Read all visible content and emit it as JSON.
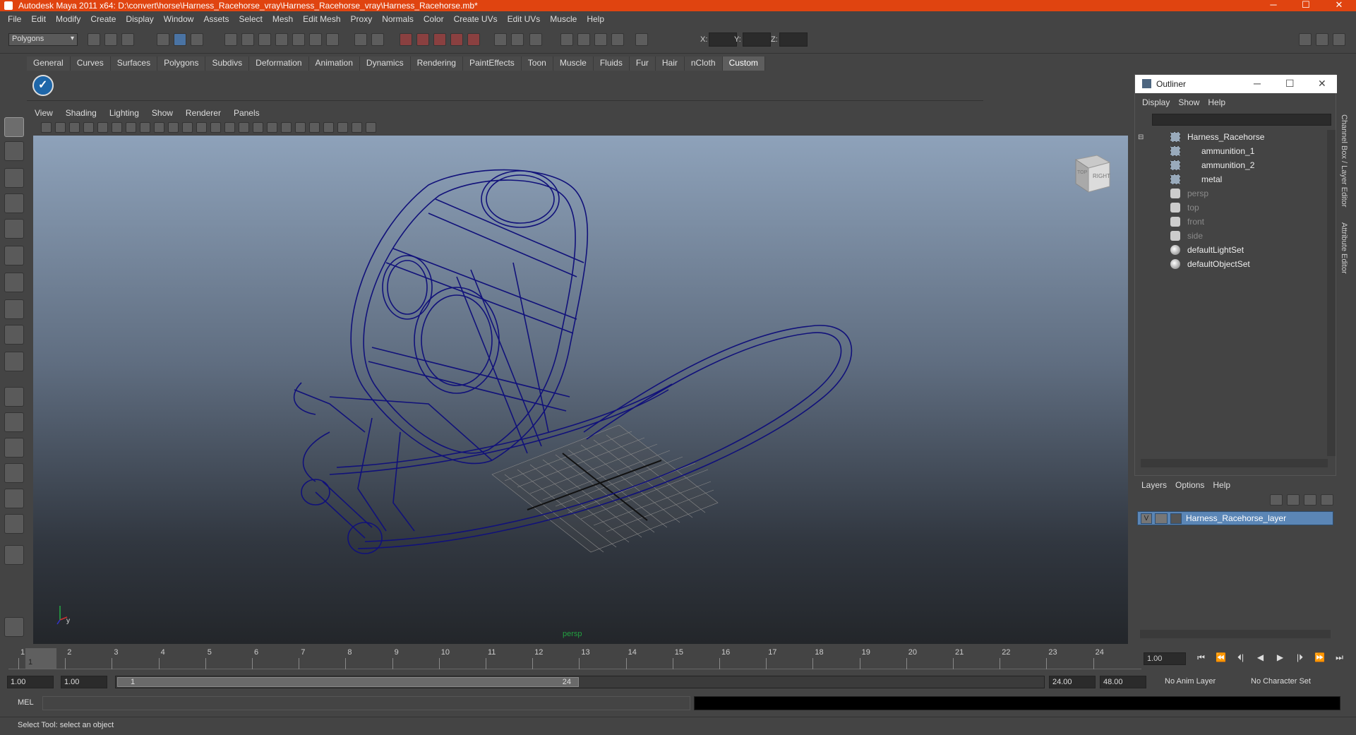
{
  "window": {
    "title": "Autodesk Maya 2011 x64: D:\\convert\\horse\\Harness_Racehorse_vray\\Harness_Racehorse_vray\\Harness_Racehorse.mb*",
    "minimize": "─",
    "maximize": "☐",
    "close": "✕"
  },
  "menubar": [
    "File",
    "Edit",
    "Modify",
    "Create",
    "Display",
    "Window",
    "Assets",
    "Select",
    "Mesh",
    "Edit Mesh",
    "Proxy",
    "Normals",
    "Color",
    "Create UVs",
    "Edit UVs",
    "Muscle",
    "Help"
  ],
  "statusline": {
    "mode": "Polygons",
    "x_label": "X:",
    "y_label": "Y:",
    "z_label": "Z:"
  },
  "shelf": {
    "tabs": [
      "General",
      "Curves",
      "Surfaces",
      "Polygons",
      "Subdivs",
      "Deformation",
      "Animation",
      "Dynamics",
      "Rendering",
      "PaintEffects",
      "Toon",
      "Muscle",
      "Fluids",
      "Fur",
      "Hair",
      "nCloth",
      "Custom"
    ],
    "active_tab": "Custom"
  },
  "panel": {
    "menus": [
      "View",
      "Shading",
      "Lighting",
      "Show",
      "Renderer",
      "Panels"
    ],
    "camera_label": "persp",
    "viewcube_labels": [
      "TOP",
      "RIGHT"
    ],
    "axis_labels": [
      "x",
      "y"
    ]
  },
  "outliner": {
    "title": "Outliner",
    "menus": [
      "Display",
      "Show",
      "Help"
    ],
    "items": [
      {
        "label": "Harness_Racehorse",
        "type": "group",
        "indent": 0,
        "dim": false
      },
      {
        "label": "ammunition_1",
        "type": "mesh",
        "indent": 1,
        "dim": false
      },
      {
        "label": "ammunition_2",
        "type": "mesh",
        "indent": 1,
        "dim": false
      },
      {
        "label": "metal",
        "type": "mesh",
        "indent": 1,
        "dim": false
      },
      {
        "label": "persp",
        "type": "camera",
        "indent": 0,
        "dim": true
      },
      {
        "label": "top",
        "type": "camera",
        "indent": 0,
        "dim": true
      },
      {
        "label": "front",
        "type": "camera",
        "indent": 0,
        "dim": true
      },
      {
        "label": "side",
        "type": "camera",
        "indent": 0,
        "dim": true
      },
      {
        "label": "defaultLightSet",
        "type": "set",
        "indent": 0,
        "dim": false
      },
      {
        "label": "defaultObjectSet",
        "type": "set",
        "indent": 0,
        "dim": false
      }
    ]
  },
  "layers": {
    "menus": [
      "Layers",
      "Options",
      "Help"
    ],
    "layer_name": "Harness_Racehorse_layer",
    "visible_flag": "V"
  },
  "sidetabs": [
    "Channel Box / Layer Editor",
    "Attribute Editor"
  ],
  "timeline": {
    "frames": [
      "1",
      "2",
      "3",
      "4",
      "5",
      "6",
      "7",
      "8",
      "9",
      "10",
      "11",
      "12",
      "13",
      "14",
      "15",
      "16",
      "17",
      "18",
      "19",
      "20",
      "21",
      "22",
      "23",
      "24"
    ],
    "current": "1",
    "current_frame_field": "1.00"
  },
  "playback": [
    "⏮",
    "⏪",
    "⏴|",
    "◀",
    "▶",
    "|⏵",
    "⏩",
    "⏭"
  ],
  "range": {
    "start": "1.00",
    "playback_start": "1.00",
    "slider_start": "1",
    "slider_end": "24",
    "playback_end": "24.00",
    "end": "48.00",
    "anim_layer": "No Anim Layer",
    "char_set": "No Character Set"
  },
  "cmdline": {
    "label": "MEL"
  },
  "helpline": {
    "text": "Select Tool: select an object"
  }
}
